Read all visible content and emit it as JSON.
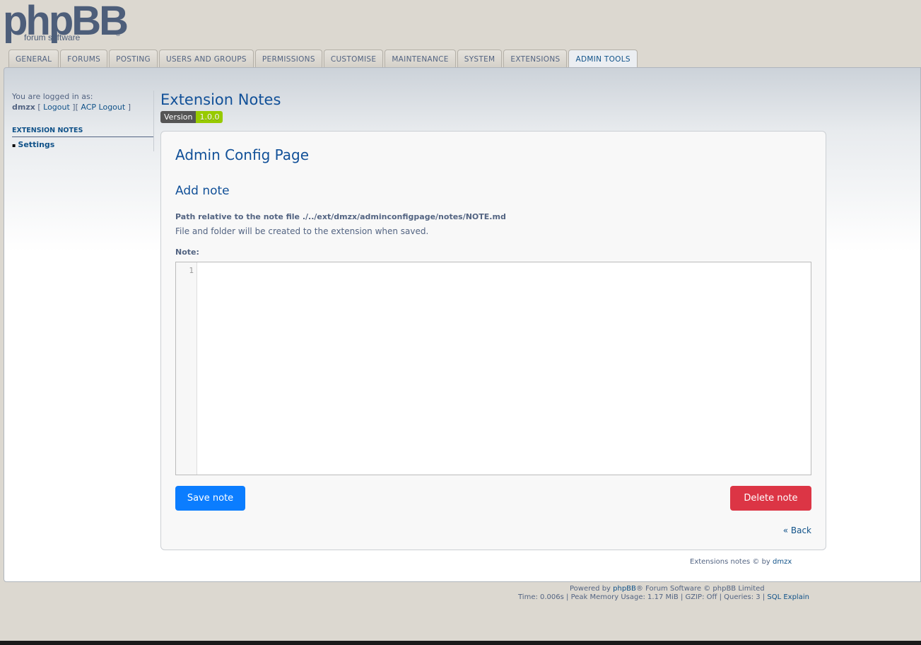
{
  "logo": {
    "text": "phpBB",
    "tagline": "forum software",
    "reg": "®"
  },
  "tabs": [
    {
      "label": "GENERAL"
    },
    {
      "label": "FORUMS"
    },
    {
      "label": "POSTING"
    },
    {
      "label": "USERS AND GROUPS"
    },
    {
      "label": "PERMISSIONS"
    },
    {
      "label": "CUSTOMISE"
    },
    {
      "label": "MAINTENANCE"
    },
    {
      "label": "SYSTEM"
    },
    {
      "label": "EXTENSIONS"
    },
    {
      "label": "ADMIN TOOLS"
    }
  ],
  "sidebar": {
    "logged_in_label": "You are logged in as:",
    "username": "dmzx",
    "bracket_open": " [ ",
    "logout": "Logout",
    "bracket_mid": " ][ ",
    "acp_logout": "ACP Logout",
    "bracket_close": " ]",
    "section_title": "EXTENSION NOTES",
    "items": [
      {
        "label": "Settings"
      }
    ]
  },
  "header": {
    "title": "Extension Notes",
    "version_label": "Version",
    "version_value": "1.0.0"
  },
  "card": {
    "title": "Admin Config Page",
    "subtitle": "Add note",
    "path_text": "Path relative to the note file ./../ext/dmzx/adminconfigpage/notes/NOTE.md",
    "sub_text": "File and folder will be created to the extension when saved.",
    "note_label": "Note:",
    "line_number": "1",
    "save_label": "Save note",
    "delete_label": "Delete note",
    "back_label": "« Back"
  },
  "credit": {
    "text": "Extensions notes © by ",
    "author": "dmzx"
  },
  "footer": {
    "powered_prefix": "Powered by ",
    "phpbb_link": "phpBB",
    "powered_suffix": "® Forum Software © phpBB Limited",
    "stats": "Time: 0.006s | Peak Memory Usage: 1.17 MiB | GZIP: Off | Queries: 3 | ",
    "sql_explain": "SQL Explain"
  },
  "colors": {
    "accent": "#105289",
    "save_button": "#0b7dff",
    "delete_button": "#dc3545",
    "version_badge": "#97ca00"
  }
}
